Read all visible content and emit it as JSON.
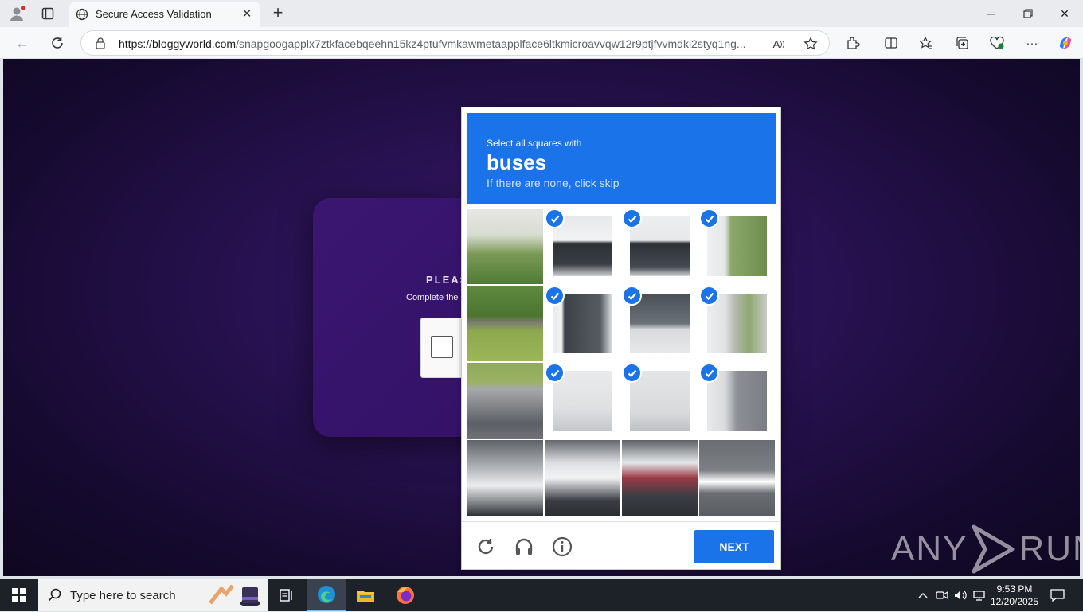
{
  "browser": {
    "tab_title": "Secure Access Validation",
    "url_host": "https://bloggyworld.com",
    "url_path": "/snapgoogapplx7ztkfacebqeehn15kz4ptufvmkawmetaapplface6ltkmicroavvqw12r9ptjfvvmdki2styq1ng...",
    "icons": [
      "profile-icon",
      "tab-actions-icon",
      "globe-icon",
      "close-icon",
      "new-tab-icon",
      "minimize-icon",
      "restore-icon",
      "window-close-icon",
      "back-icon",
      "refresh-icon",
      "lock-icon",
      "read-aloud-icon",
      "favorite-star-icon",
      "extensions-icon",
      "split-screen-icon",
      "favorites-icon",
      "collections-icon",
      "performance-icon",
      "more-icon",
      "copilot-icon"
    ]
  },
  "page": {
    "card_title": "PLEASE",
    "card_subtitle": "Complete the"
  },
  "captcha": {
    "instruction": "Select all squares with",
    "target": "buses",
    "skip_hint": "If there are none, click skip",
    "next_label": "NEXT",
    "selected_tiles": [
      1,
      2,
      3,
      5,
      6,
      7,
      9,
      10,
      11
    ],
    "accent": "#1a73e8"
  },
  "watermark": {
    "left": "ANY",
    "right": "RUN"
  },
  "taskbar": {
    "search_placeholder": "Type here to search",
    "time": "9:53 PM",
    "date": "12/20/2025"
  }
}
